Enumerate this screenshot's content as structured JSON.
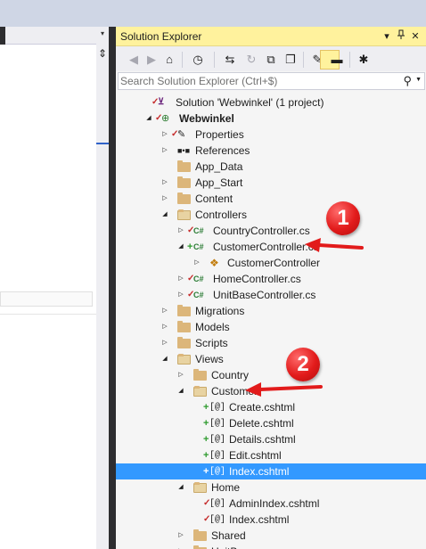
{
  "solution_explorer": {
    "title": "Solution Explorer",
    "title_buttons": {
      "dropdown": "▾",
      "pin": "ᵖ",
      "close": "✕"
    },
    "toolbar": [
      {
        "name": "back-icon",
        "glyph": "◀",
        "dim": true
      },
      {
        "name": "forward-icon",
        "glyph": "▶",
        "dim": true
      },
      {
        "name": "home-icon",
        "glyph": "⌂",
        "dim": false
      },
      {
        "name": "history-icon",
        "glyph": "◷",
        "dim": false
      },
      {
        "name": "sync-icon",
        "glyph": "⇆",
        "dim": false
      },
      {
        "name": "refresh-icon",
        "glyph": "↻",
        "dim": true
      },
      {
        "name": "collapse-all-icon",
        "glyph": "⧉",
        "dim": false
      },
      {
        "name": "show-all-files-icon",
        "glyph": "❐",
        "dim": false
      },
      {
        "name": "properties-icon",
        "glyph": "✎",
        "dim": false
      },
      {
        "name": "preview-icon",
        "glyph": "▬",
        "dim": false
      },
      {
        "name": "settings-icon",
        "glyph": "✱",
        "dim": false
      }
    ],
    "search": {
      "placeholder": "Search Solution Explorer (Ctrl+$)",
      "value": ""
    },
    "tree": [
      {
        "label": "Solution 'Webwinkel' (1 project)",
        "type": "solution",
        "indent": 0,
        "expander": "",
        "marker": "✓"
      },
      {
        "label": "Webwinkel",
        "type": "project",
        "indent": 1,
        "expander": "◢",
        "marker": "✓",
        "bold": true
      },
      {
        "label": "Properties",
        "type": "properties",
        "indent": 2,
        "expander": "▷",
        "marker": "✓"
      },
      {
        "label": "References",
        "type": "references",
        "indent": 2,
        "expander": "▷",
        "marker": ""
      },
      {
        "label": "App_Data",
        "type": "folder",
        "indent": 2,
        "expander": "",
        "marker": ""
      },
      {
        "label": "App_Start",
        "type": "folder",
        "indent": 2,
        "expander": "▷",
        "marker": ""
      },
      {
        "label": "Content",
        "type": "folder",
        "indent": 2,
        "expander": "▷",
        "marker": ""
      },
      {
        "label": "Controllers",
        "type": "folder-open",
        "indent": 2,
        "expander": "◢",
        "marker": ""
      },
      {
        "label": "CountryController.cs",
        "type": "cs",
        "indent": 3,
        "expander": "▷",
        "marker": "✓"
      },
      {
        "label": "CustomerController.cs",
        "type": "cs",
        "indent": 3,
        "expander": "◢",
        "marker": "+"
      },
      {
        "label": "CustomerController",
        "type": "class",
        "indent": 4,
        "expander": "▷",
        "marker": ""
      },
      {
        "label": "HomeController.cs",
        "type": "cs",
        "indent": 3,
        "expander": "▷",
        "marker": "✓"
      },
      {
        "label": "UnitBaseController.cs",
        "type": "cs",
        "indent": 3,
        "expander": "▷",
        "marker": "✓"
      },
      {
        "label": "Migrations",
        "type": "folder",
        "indent": 2,
        "expander": "▷",
        "marker": ""
      },
      {
        "label": "Models",
        "type": "folder",
        "indent": 2,
        "expander": "▷",
        "marker": ""
      },
      {
        "label": "Scripts",
        "type": "folder",
        "indent": 2,
        "expander": "▷",
        "marker": ""
      },
      {
        "label": "Views",
        "type": "folder-open",
        "indent": 2,
        "expander": "◢",
        "marker": ""
      },
      {
        "label": "Country",
        "type": "folder",
        "indent": 3,
        "expander": "▷",
        "marker": ""
      },
      {
        "label": "Customer",
        "type": "folder-open",
        "indent": 3,
        "expander": "◢",
        "marker": ""
      },
      {
        "label": "Create.cshtml",
        "type": "razor",
        "indent": 4,
        "expander": "",
        "marker": "+"
      },
      {
        "label": "Delete.cshtml",
        "type": "razor",
        "indent": 4,
        "expander": "",
        "marker": "+"
      },
      {
        "label": "Details.cshtml",
        "type": "razor",
        "indent": 4,
        "expander": "",
        "marker": "+"
      },
      {
        "label": "Edit.cshtml",
        "type": "razor",
        "indent": 4,
        "expander": "",
        "marker": "+"
      },
      {
        "label": "Index.cshtml",
        "type": "razor",
        "indent": 4,
        "expander": "",
        "marker": "+",
        "selected": true
      },
      {
        "label": "Home",
        "type": "folder-open",
        "indent": 3,
        "expander": "◢",
        "marker": ""
      },
      {
        "label": "AdminIndex.cshtml",
        "type": "razor",
        "indent": 4,
        "expander": "",
        "marker": "✓"
      },
      {
        "label": "Index.cshtml",
        "type": "razor",
        "indent": 4,
        "expander": "",
        "marker": "✓"
      },
      {
        "label": "Shared",
        "type": "folder",
        "indent": 3,
        "expander": "▷",
        "marker": ""
      },
      {
        "label": "UnitB…",
        "type": "folder",
        "indent": 3,
        "expander": "▷",
        "marker": ""
      }
    ]
  },
  "callouts": [
    {
      "label": "1",
      "target": "CustomerController.cs"
    },
    {
      "label": "2",
      "target": "Customer"
    }
  ],
  "editor": {
    "dropdown_glyph": "▾",
    "splitter_glyph": "⇕"
  },
  "colors": {
    "title_bar": "#fff29d",
    "selection": "#3399ff",
    "callout_red": "#e21b1b",
    "folder": "#dcb67a",
    "cs_green": "#2a7b34",
    "check_red": "#c52a2a"
  }
}
